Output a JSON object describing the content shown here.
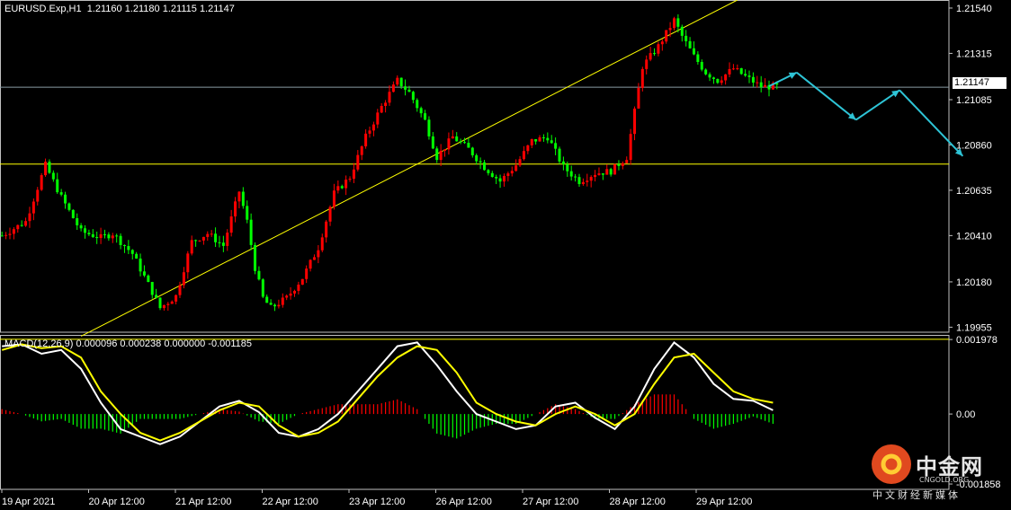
{
  "chart_data": [
    {
      "type": "candlestick",
      "symbol": "EURUSD.Exp,H1",
      "header": {
        "title": "EURUSD.Exp,H1",
        "open": "1.21160",
        "high": "1.21180",
        "low": "1.21115",
        "close": "1.21147"
      },
      "current_price": "1.21147",
      "y_ticks": [
        "1.21540",
        "1.21315",
        "1.21085",
        "1.20860",
        "1.20635",
        "1.20410",
        "1.20180",
        "1.19955"
      ],
      "y_tick_values": [
        1.2154,
        1.21315,
        1.21085,
        1.2086,
        1.20635,
        1.2041,
        1.2018,
        1.19955
      ],
      "ylim": [
        1.1993,
        1.2158
      ],
      "x_ticks": [
        "19 Apr 2021",
        "20 Apr 12:00",
        "21 Apr 12:00",
        "22 Apr 12:00",
        "23 Apr 12:00",
        "26 Apr 12:00",
        "27 Apr 12:00",
        "28 Apr 12:00",
        "29 Apr 12:00"
      ],
      "bull_color": "#ff0000",
      "bear_color": "#00ff00",
      "path_points": [
        [
          0,
          1.2041
        ],
        [
          6,
          1.2048
        ],
        [
          11,
          1.2076
        ],
        [
          15,
          1.206
        ],
        [
          20,
          1.2043
        ],
        [
          25,
          1.204
        ],
        [
          28,
          1.2042
        ],
        [
          33,
          1.2032
        ],
        [
          38,
          1.2013
        ],
        [
          40,
          1.2005
        ],
        [
          44,
          1.2011
        ],
        [
          48,
          1.2038
        ],
        [
          52,
          1.2042
        ],
        [
          56,
          1.2036
        ],
        [
          60,
          1.2063
        ],
        [
          62,
          1.2048
        ],
        [
          64,
          1.2025
        ],
        [
          66,
          1.201
        ],
        [
          68,
          1.2005
        ],
        [
          72,
          1.201
        ],
        [
          76,
          1.202
        ],
        [
          80,
          1.2035
        ],
        [
          84,
          1.2062
        ],
        [
          88,
          1.207
        ],
        [
          92,
          1.209
        ],
        [
          96,
          1.2105
        ],
        [
          100,
          1.2118
        ],
        [
          103,
          1.2112
        ],
        [
          107,
          1.2098
        ],
        [
          110,
          1.208
        ],
        [
          114,
          1.209
        ],
        [
          118,
          1.2084
        ],
        [
          122,
          1.2075
        ],
        [
          126,
          1.2068
        ],
        [
          130,
          1.2076
        ],
        [
          134,
          1.2088
        ],
        [
          138,
          1.209
        ],
        [
          142,
          1.2075
        ],
        [
          146,
          1.2068
        ],
        [
          150,
          1.2072
        ],
        [
          154,
          1.2073
        ],
        [
          158,
          1.208
        ],
        [
          162,
          1.2125
        ],
        [
          166,
          1.2135
        ],
        [
          170,
          1.2148
        ],
        [
          172,
          1.214
        ],
        [
          175,
          1.213
        ],
        [
          178,
          1.2122
        ],
        [
          181,
          1.2118
        ],
        [
          185,
          1.2124
        ],
        [
          188,
          1.212
        ],
        [
          192,
          1.2115
        ],
        [
          196,
          1.2115
        ]
      ],
      "objects": {
        "horizontal_lines": [
          1.21147,
          1.20765,
          1.19895
        ],
        "trendline": [
          [
            20,
            1.1991
          ],
          [
            186,
            1.2158
          ]
        ],
        "forecast_path": [
          [
            194,
            1.21152
          ],
          [
            201,
            1.2122
          ],
          [
            216,
            1.20985
          ],
          [
            227,
            1.21132
          ],
          [
            243,
            1.20805
          ]
        ],
        "line_color": "#ffff00",
        "arrow_color": "#2ec4d6"
      }
    },
    {
      "type": "macd",
      "header": "MACD(12,26,9) 0.000096 0.000238 0.000000 -0.001185",
      "y_ticks": [
        "0.001978",
        "0.00",
        "-0.001858"
      ],
      "y_tick_values": [
        0.001978,
        0.0,
        -0.001858
      ],
      "ylim": [
        -0.002,
        0.0021
      ],
      "series": [
        {
          "name": "MACD",
          "color": "#ffffff",
          "values": [
            [
              0,
              0.0018
            ],
            [
              5,
              0.00185
            ],
            [
              10,
              0.0016
            ],
            [
              15,
              0.0017
            ],
            [
              20,
              0.0012
            ],
            [
              25,
              0.0003
            ],
            [
              30,
              -0.0004
            ],
            [
              35,
              -0.0006
            ],
            [
              40,
              -0.0008
            ],
            [
              45,
              -0.0006
            ],
            [
              50,
              -0.0002
            ],
            [
              55,
              0.0002
            ],
            [
              60,
              0.00035
            ],
            [
              65,
              5e-05
            ],
            [
              70,
              -0.0005
            ],
            [
              75,
              -0.0006
            ],
            [
              80,
              -0.0004
            ],
            [
              85,
              0.0
            ],
            [
              90,
              0.0006
            ],
            [
              95,
              0.0012
            ],
            [
              100,
              0.0018
            ],
            [
              105,
              0.0019
            ],
            [
              110,
              0.0013
            ],
            [
              115,
              0.0006
            ],
            [
              120,
              0.0
            ],
            [
              125,
              -0.0002
            ],
            [
              130,
              -0.0004
            ],
            [
              135,
              -0.0003
            ],
            [
              140,
              0.0002
            ],
            [
              145,
              0.0003
            ],
            [
              150,
              -0.0001
            ],
            [
              155,
              -0.0004
            ],
            [
              160,
              0.0002
            ],
            [
              165,
              0.0012
            ],
            [
              170,
              0.0019
            ],
            [
              175,
              0.0015
            ],
            [
              180,
              0.0008
            ],
            [
              185,
              0.0004
            ],
            [
              190,
              0.00035
            ],
            [
              195,
              0.0001
            ]
          ]
        },
        {
          "name": "Signal",
          "color": "#ffff00",
          "values": [
            [
              0,
              0.0017
            ],
            [
              5,
              0.00185
            ],
            [
              10,
              0.00175
            ],
            [
              15,
              0.0018
            ],
            [
              20,
              0.0015
            ],
            [
              25,
              0.0006
            ],
            [
              30,
              0.0
            ],
            [
              35,
              -0.0005
            ],
            [
              40,
              -0.0007
            ],
            [
              45,
              -0.0005
            ],
            [
              50,
              -0.0002
            ],
            [
              55,
              0.0001
            ],
            [
              60,
              0.0003
            ],
            [
              65,
              0.0002
            ],
            [
              70,
              -0.0003
            ],
            [
              75,
              -0.0006
            ],
            [
              80,
              -0.0005
            ],
            [
              85,
              -0.0002
            ],
            [
              90,
              0.0004
            ],
            [
              95,
              0.001
            ],
            [
              100,
              0.0015
            ],
            [
              105,
              0.0018
            ],
            [
              110,
              0.0017
            ],
            [
              115,
              0.0011
            ],
            [
              120,
              0.0003
            ],
            [
              125,
              0.0
            ],
            [
              130,
              -0.0002
            ],
            [
              135,
              -0.0003
            ],
            [
              140,
              0.0
            ],
            [
              145,
              0.0002
            ],
            [
              150,
              0.0
            ],
            [
              155,
              -0.0003
            ],
            [
              160,
              0.0
            ],
            [
              165,
              0.0008
            ],
            [
              170,
              0.0015
            ],
            [
              175,
              0.0016
            ],
            [
              180,
              0.0011
            ],
            [
              185,
              0.0006
            ],
            [
              190,
              0.0004
            ],
            [
              195,
              0.0003
            ]
          ]
        }
      ],
      "histogram_colors": {
        "positive": "#ff0000",
        "negative": "#00ff00"
      }
    }
  ],
  "watermark": {
    "title": "中金网",
    "subtitle": "CNGOLD.ORG",
    "tagline": "中文财经新媒体"
  }
}
